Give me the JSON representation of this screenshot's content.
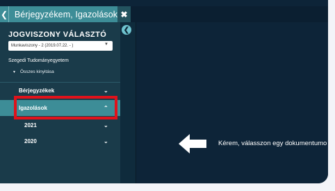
{
  "window": {
    "title": "Bérjegyzékem, Igazolások",
    "back_icon": "back-arrow-icon",
    "close_icon": "close-icon"
  },
  "sidebar": {
    "heading": "JOGVISZONY VÁLASZTÓ",
    "select_value": "Munkaviszony - 2 (2019.07.22. - )",
    "organization": "Szegedi Tudományegyetem",
    "expand_all": "Összes kinyitása",
    "items": [
      {
        "label": "Bérjegyzékek",
        "chevron": "chevron-down-icon"
      },
      {
        "label": "Igazolások",
        "chevron": "chevron-up-icon",
        "active": true
      },
      {
        "label": "2021",
        "chevron": "chevron-down-icon"
      },
      {
        "label": "2020",
        "chevron": "chevron-down-icon"
      }
    ]
  },
  "main": {
    "message": "Kérem, válasszon egy dokumentumo"
  },
  "colors": {
    "accent": "#3d8d97",
    "sidebar": "#1a3b4a",
    "background": "#0d2438",
    "highlight": "#e0121b"
  }
}
